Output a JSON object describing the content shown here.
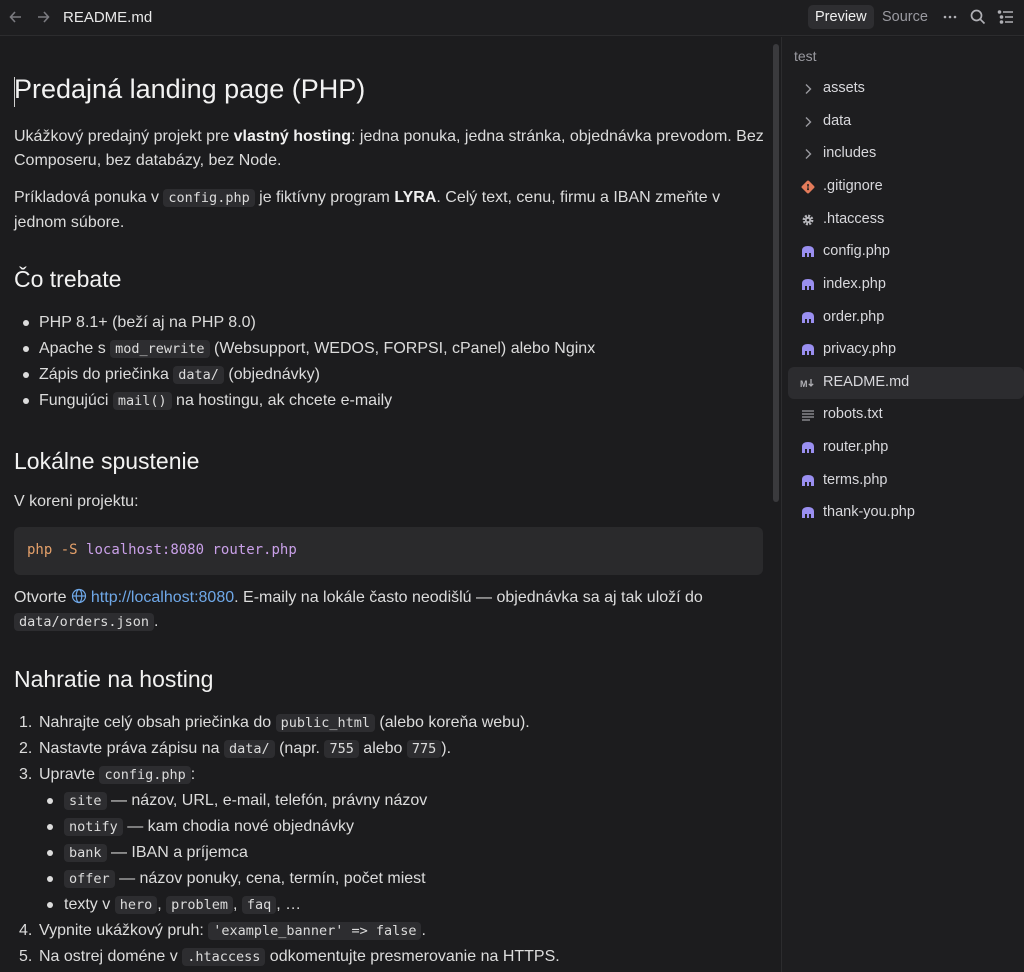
{
  "window": {
    "file_title": "README.md",
    "mode_preview": "Preview",
    "mode_source": "Source"
  },
  "doc": {
    "h1": "Predajná landing page (PHP)",
    "intro_a": "Ukážkový predajný projekt pre ",
    "intro_bold": "vlastný hosting",
    "intro_b": ": jedna ponuka, jedna stránka, objednávka prevodom. Bez Composeru, bez databázy, bez Node.",
    "p2_a": "Príkladová ponuka v ",
    "p2_code": "config.php",
    "p2_b": " je fiktívny program ",
    "p2_bold": "LYRA",
    "p2_c": ". Celý text, cenu, firmu a IBAN zmeňte v jednom súbore.",
    "h2_need": "Čo trebate",
    "need": {
      "i1": "PHP 8.1+ (beží aj na PHP 8.0)",
      "i2_a": "Apache s ",
      "i2_code": "mod_rewrite",
      "i2_b": " (Websupport, WEDOS, FORPSI, cPanel) alebo Nginx",
      "i3_a": "Zápis do priečinka ",
      "i3_code": "data/",
      "i3_b": " (objednávky)",
      "i4_a": "Fungujúci ",
      "i4_code": "mail()",
      "i4_b": " na hostingu, ak chcete e-maily"
    },
    "h2_local": "Lokálne spustenie",
    "local_p": "V koreni projektu:",
    "cmd_php": "php",
    "cmd_flag": "-S",
    "cmd_host": "localhost:8080",
    "cmd_router": "router.php",
    "open_a": "Otvorte ",
    "open_link": "http://localhost:8080",
    "open_b": ". E-maily na lokále často neodišlú — objednávka sa aj tak uloží do ",
    "open_code": "data/orders.json",
    "open_c": ".",
    "h2_upload": "Nahratie na hosting",
    "steps": {
      "n1": "1.",
      "s1_a": "Nahrajte celý obsah priečinka do ",
      "s1_code": "public_html",
      "s1_b": " (alebo koreňa webu).",
      "n2": "2.",
      "s2_a": "Nastavte práva zápisu na ",
      "s2_code": "data/",
      "s2_b": " (napr. ",
      "s2_c1": "755",
      "s2_c": " alebo ",
      "s2_c2": "775",
      "s2_d": ").",
      "n3": "3.",
      "s3_a": "Upravte ",
      "s3_code": "config.php",
      "s3_b": ":",
      "sub1_code": "site",
      "sub1": " — názov, URL, e-mail, telefón, právny názov",
      "sub2_code": "notify",
      "sub2": " — kam chodia nové objednávky",
      "sub3_code": "bank",
      "sub3": " — IBAN a príjemca",
      "sub4_code": "offer",
      "sub4": " — názov ponuky, cena, termín, počet miest",
      "sub5_a": "texty v ",
      "sub5_c1": "hero",
      "sub5_sep1": ", ",
      "sub5_c2": "problem",
      "sub5_sep2": ", ",
      "sub5_c3": "faq",
      "sub5_b": ", …",
      "n4": "4.",
      "s4_a": "Vypnite ukážkový pruh: ",
      "s4_code": "'example_banner' => false",
      "s4_b": ".",
      "n5": "5.",
      "s5_a": "Na ostrej doméne v ",
      "s5_code": ".htaccess",
      "s5_b": " odkomentujte presmerovanie na HTTPS."
    }
  },
  "sidebar": {
    "root": "test",
    "items": [
      {
        "label": "assets",
        "icon": "chevron-right-icon"
      },
      {
        "label": "data",
        "icon": "chevron-right-icon"
      },
      {
        "label": "includes",
        "icon": "chevron-right-icon"
      },
      {
        "label": ".gitignore",
        "icon": "git-icon"
      },
      {
        "label": ".htaccess",
        "icon": "gear-icon"
      },
      {
        "label": "config.php",
        "icon": "php-icon"
      },
      {
        "label": "index.php",
        "icon": "php-icon"
      },
      {
        "label": "order.php",
        "icon": "php-icon"
      },
      {
        "label": "privacy.php",
        "icon": "php-icon"
      },
      {
        "label": "README.md",
        "icon": "markdown-icon"
      },
      {
        "label": "robots.txt",
        "icon": "text-file-icon"
      },
      {
        "label": "router.php",
        "icon": "php-icon"
      },
      {
        "label": "terms.php",
        "icon": "php-icon"
      },
      {
        "label": "thank-you.php",
        "icon": "php-icon"
      }
    ],
    "active_item": "README.md"
  },
  "colors": {
    "background": "#1c1c1e",
    "link": "#6fa8e8",
    "php_icon": "#9a8ff0",
    "git_icon": "#e37b5a"
  }
}
